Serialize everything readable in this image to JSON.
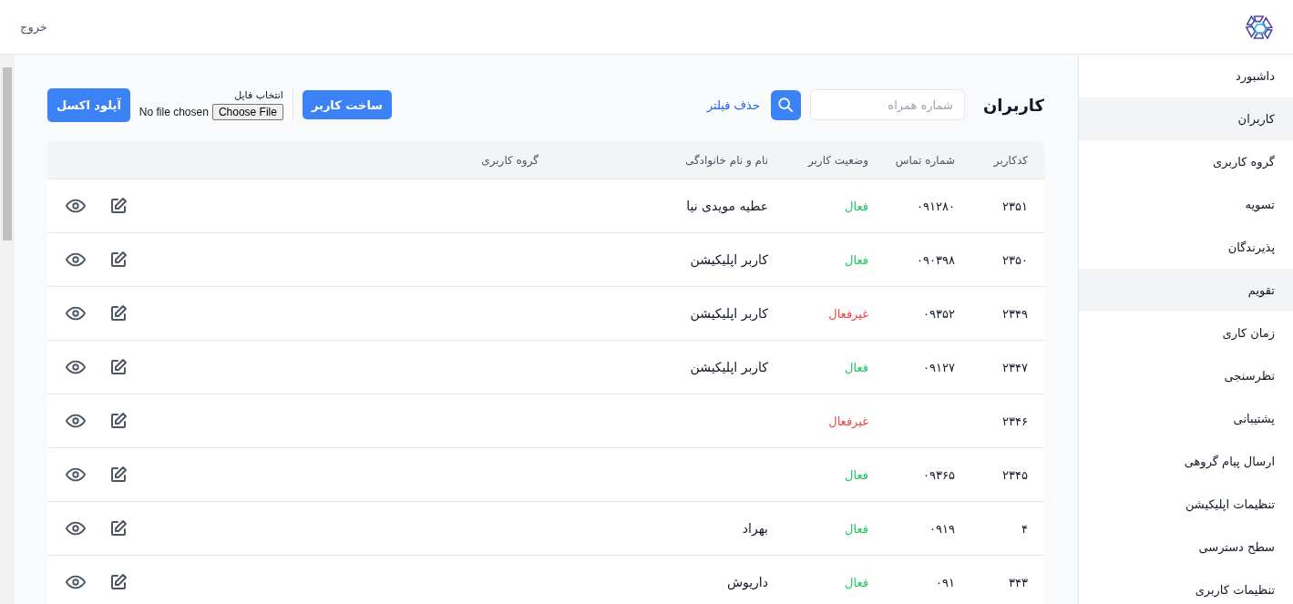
{
  "header": {
    "logout": "خروج"
  },
  "sidebar": {
    "items": [
      {
        "label": "داشبورد",
        "selected": false
      },
      {
        "label": "کاربران",
        "selected": true
      },
      {
        "label": "گروه کاربری",
        "selected": false
      },
      {
        "label": "تسویه",
        "selected": false
      },
      {
        "label": "پذیرندگان",
        "selected": false
      },
      {
        "label": "تقویم",
        "selected": true
      },
      {
        "label": "زمان کاری",
        "selected": false
      },
      {
        "label": "نظرسنجی",
        "selected": false
      },
      {
        "label": "پشتیبانی",
        "selected": false
      },
      {
        "label": "ارسال پیام گروهی",
        "selected": false
      },
      {
        "label": "تنظیمات اپلیکیشن",
        "selected": false
      },
      {
        "label": "سطح دسترسی",
        "selected": false
      },
      {
        "label": "تنظیمات کاربری",
        "selected": false
      }
    ]
  },
  "page_title": "کاربران",
  "search": {
    "placeholder": "شماره همراه"
  },
  "clear_filter": "حذف فیلتر",
  "create_user": "ساخت کاربر",
  "file_picker": {
    "label": "انتخاب فایل",
    "button": "Choose File",
    "status": "No file chosen"
  },
  "upload_excel": "آپلود اکسل",
  "table": {
    "columns": [
      "کدکاربر",
      "شماره تماس",
      "وضعیت کاربر",
      "نام و نام خانوادگی",
      "گروه کاربری"
    ],
    "rows": [
      {
        "code": "۲۳۵۱",
        "phone": "۰۹۱۲۸۰",
        "status": "فعال",
        "active": true,
        "name": "عطیه مویدی نیا"
      },
      {
        "code": "۲۳۵۰",
        "phone": "۰۹۰۳۹۸",
        "status": "فعال",
        "active": true,
        "name": "کاربر اپلیکیشن"
      },
      {
        "code": "۲۳۴۹",
        "phone": "۰۹۳۵۲",
        "status": "غیرفعال",
        "active": false,
        "name": "کاربر اپلیکیشن"
      },
      {
        "code": "۲۳۴۷",
        "phone": "۰۹۱۲۷",
        "status": "فعال",
        "active": true,
        "name": "کاربر اپلیکیشن"
      },
      {
        "code": "۲۳۴۶",
        "status": "غیرفعال",
        "active": false
      },
      {
        "code": "۲۳۴۵",
        "phone": "۰۹۳۶۵",
        "status": "فعال",
        "active": true
      },
      {
        "code": "۴",
        "phone": "۰۹۱۹",
        "status": "فعال",
        "active": true,
        "name": "بهراد"
      },
      {
        "code": "۳۴۳",
        "phone": "۰۹۱",
        "status": "فعال",
        "active": true,
        "name": "داریوش"
      }
    ]
  }
}
